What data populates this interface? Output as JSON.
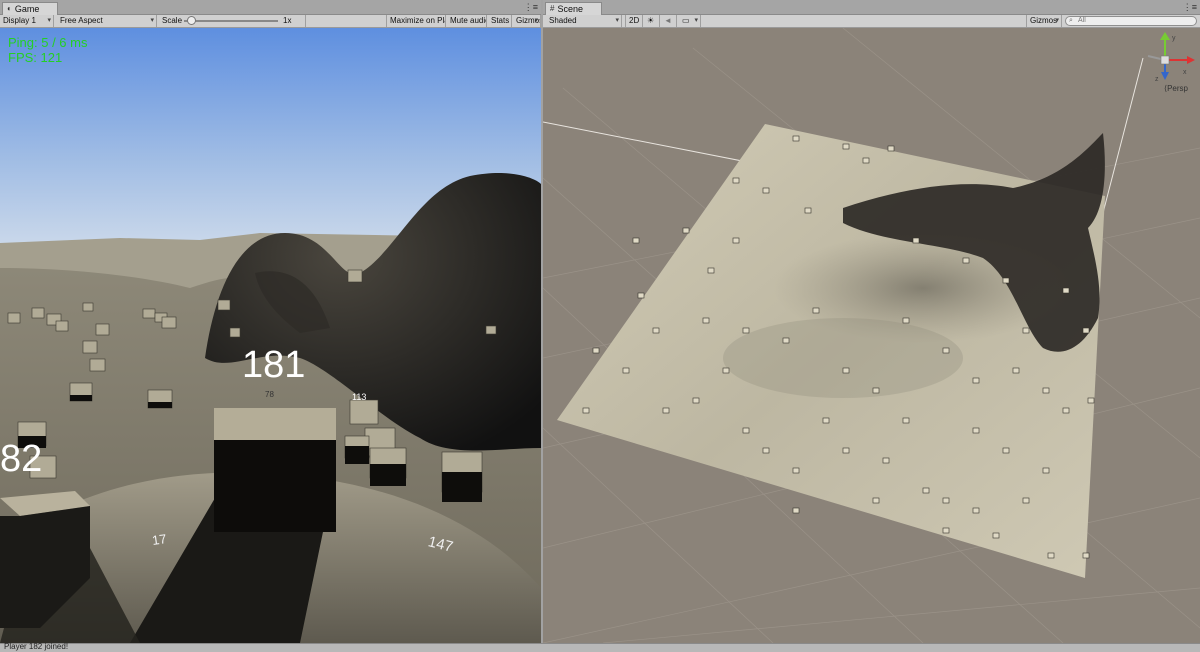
{
  "game": {
    "tab_label": "Game",
    "tab_icon": "gamepad-icon",
    "toolbar": {
      "display": "Display 1",
      "aspect": "Free Aspect",
      "scale_label": "Scale",
      "scale_value": "1x",
      "scale_level": 0.05,
      "maximize": "Maximize on Play",
      "mute": "Mute audio",
      "stats": "Stats",
      "gizmos": "Gizmos"
    },
    "hud": {
      "ping": "Ping: 5 / 6 ms",
      "fps": "FPS: 121"
    },
    "labels": {
      "player_181": "181",
      "player_182": "82",
      "ground_17": "17",
      "ground_147": "147",
      "box_113": "113",
      "box_78": "78"
    }
  },
  "scene": {
    "tab_label": "Scene",
    "tab_icon": "scene-grid-icon",
    "toolbar": {
      "shading": "Shaded",
      "mode_2d": "2D",
      "gizmos": "Gizmos",
      "search_placeholder": "All"
    },
    "gizmo": {
      "label": "Persp",
      "axis_x": "x",
      "axis_y": "y",
      "axis_z": "z"
    }
  },
  "status": {
    "message": "Player 182 joined!"
  },
  "colors": {
    "sky_top": "#5e8fe0",
    "sky_bottom": "#c9d9ea",
    "terrain": "#a8a290",
    "scene_bg": "#8a8178",
    "hud_green": "#24d024"
  }
}
